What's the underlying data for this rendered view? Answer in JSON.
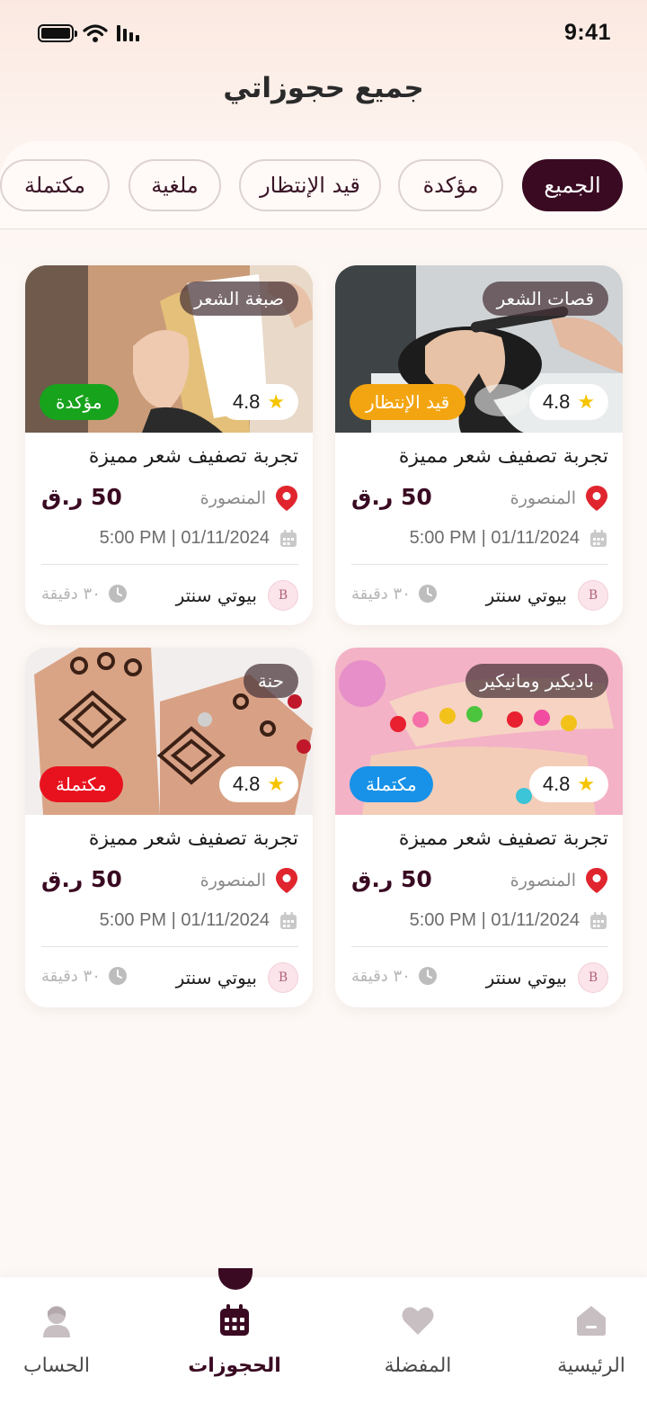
{
  "status_bar": {
    "time": "9:41"
  },
  "header": {
    "title": "جميع حجوزاتي"
  },
  "filters": [
    {
      "label": "الجميع",
      "active": true
    },
    {
      "label": "مؤكدة",
      "active": false
    },
    {
      "label": "قيد الإنتظار",
      "active": false
    },
    {
      "label": "ملغية",
      "active": false
    },
    {
      "label": "مكتملة",
      "active": false
    }
  ],
  "bookings": [
    {
      "category": "قصات الشعر",
      "rating": "4.8",
      "status": "قيد الإنتظار",
      "status_color": "#f3a511",
      "image_icon": "hair-wash-photo",
      "title": "تجربة تصفيف شعر مميزة",
      "location": "المنصورة",
      "price": "50 ر.ق",
      "datetime": "5:00 PM | 01/11/2024",
      "provider": "بيوتي سنتر",
      "duration": "٣٠ دقيقة"
    },
    {
      "category": "صبغة الشعر",
      "rating": "4.8",
      "status": "مؤكدة",
      "status_color": "#18a31d",
      "image_icon": "hair-dye-photo",
      "title": "تجربة تصفيف شعر مميزة",
      "location": "المنصورة",
      "price": "50 ر.ق",
      "datetime": "5:00 PM | 01/11/2024",
      "provider": "بيوتي سنتر",
      "duration": "٣٠ دقيقة"
    },
    {
      "category": "باديكير ومانيكير",
      "rating": "4.8",
      "status": "مكتملة",
      "status_color": "#1792e8",
      "image_icon": "manicure-photo",
      "title": "تجربة تصفيف شعر مميزة",
      "location": "المنصورة",
      "price": "50 ر.ق",
      "datetime": "5:00 PM | 01/11/2024",
      "provider": "بيوتي سنتر",
      "duration": "٣٠ دقيقة"
    },
    {
      "category": "حنة",
      "rating": "4.8",
      "status": "مكتملة",
      "status_color": "#e8121e",
      "image_icon": "henna-photo",
      "title": "تجربة تصفيف شعر مميزة",
      "location": "المنصورة",
      "price": "50 ر.ق",
      "datetime": "5:00 PM | 01/11/2024",
      "provider": "بيوتي سنتر",
      "duration": "٣٠ دقيقة"
    }
  ],
  "provider_logo_letter": "B",
  "bottom_nav": [
    {
      "label": "الرئيسية",
      "icon": "home-icon",
      "active": false
    },
    {
      "label": "المفضلة",
      "icon": "heart-icon",
      "active": false
    },
    {
      "label": "الحجوزات",
      "icon": "calendar-icon",
      "active": true
    },
    {
      "label": "الحساب",
      "icon": "profile-icon",
      "active": false
    }
  ],
  "colors": {
    "brand": "#3a0a22",
    "accent_pin": "#e0252f",
    "star": "#f6c400"
  }
}
